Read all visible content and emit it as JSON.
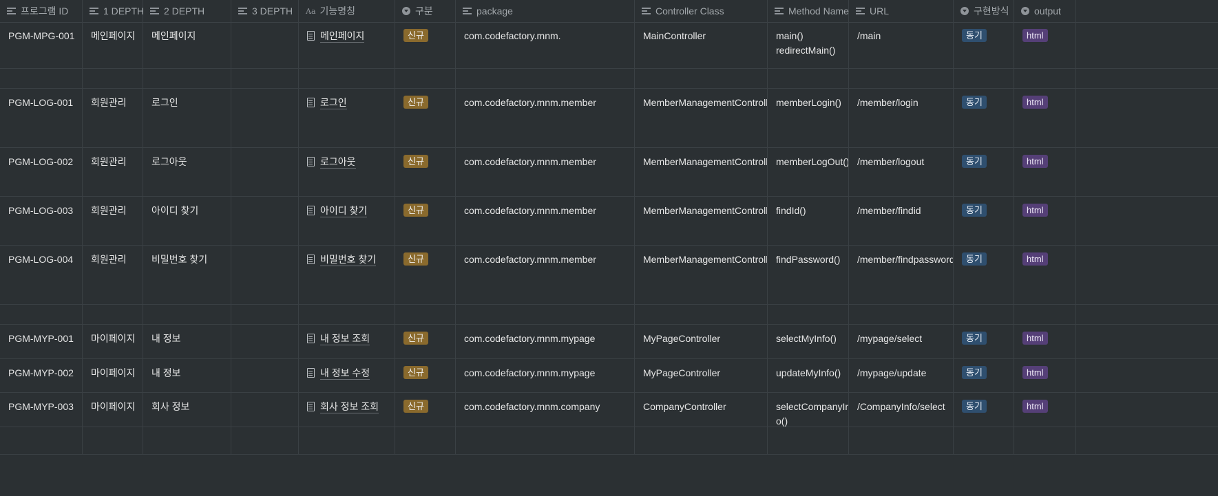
{
  "colors": {
    "background": "#2b3033",
    "badge_new": "#8a6a2d",
    "badge_sync": "#2f4f6f",
    "badge_html": "#553f77"
  },
  "columns": [
    {
      "label": "프로그램 ID",
      "icon": "text-lines-icon"
    },
    {
      "label": "1 DEPTH",
      "icon": "text-lines-icon"
    },
    {
      "label": "2 DEPTH",
      "icon": "text-lines-icon"
    },
    {
      "label": "3 DEPTH",
      "icon": "text-lines-icon"
    },
    {
      "label": "기능명칭",
      "icon": "title-aa-icon"
    },
    {
      "label": "구분",
      "icon": "select-icon"
    },
    {
      "label": "package",
      "icon": "text-lines-icon"
    },
    {
      "label": "Controller Class",
      "icon": "text-lines-icon"
    },
    {
      "label": "Method Name",
      "icon": "text-lines-icon"
    },
    {
      "label": "URL",
      "icon": "text-lines-icon"
    },
    {
      "label": "구현방식",
      "icon": "select-icon"
    },
    {
      "label": "output",
      "icon": "select-icon"
    }
  ],
  "title_icon_text": "Aa",
  "rows": [
    {
      "id": "PGM-MPG-001",
      "d1": "메인페이지",
      "d2": "메인페이지",
      "d3": "",
      "name": "메인페이지",
      "type": "신규",
      "package": "com.codefactory.mnm.",
      "controller": "MainController",
      "method": [
        "main()",
        "redirectMain()"
      ],
      "url": "/main",
      "impl": "동기",
      "output": "html"
    },
    {
      "id": "",
      "d1": "",
      "d2": "",
      "d3": "",
      "name": "",
      "type": "",
      "package": "",
      "controller": "",
      "method": [],
      "url": "",
      "impl": "",
      "output": ""
    },
    {
      "id": "PGM-LOG-001",
      "d1": "회원관리",
      "d2": "로그인",
      "d3": "",
      "name": "로그인",
      "type": "신규",
      "package": "com.codefactory.mnm.member",
      "controller": "MemberManagementController",
      "method": [
        "memberLogin()"
      ],
      "url": "/member/login",
      "impl": "동기",
      "output": "html"
    },
    {
      "id": "PGM-LOG-002",
      "d1": "회원관리",
      "d2": "로그아웃",
      "d3": "",
      "name": "로그아웃",
      "type": "신규",
      "package": "com.codefactory.mnm.member",
      "controller": "MemberManagementController",
      "method": [
        "memberLogOut()"
      ],
      "url": "/member/logout",
      "impl": "동기",
      "output": "html"
    },
    {
      "id": "PGM-LOG-003",
      "d1": "회원관리",
      "d2": "아이디 찾기",
      "d3": "",
      "name": "아이디 찾기",
      "type": "신규",
      "package": "com.codefactory.mnm.member",
      "controller": "MemberManagementController",
      "method": [
        "findId()"
      ],
      "url": "/member/findid",
      "impl": "동기",
      "output": "html"
    },
    {
      "id": "PGM-LOG-004",
      "d1": "회원관리",
      "d2": "비밀번호 찾기",
      "d3": "",
      "name": "비밀번호 찾기",
      "type": "신규",
      "package": "com.codefactory.mnm.member",
      "controller": "MemberManagementController",
      "method": [
        "findPassword()"
      ],
      "url": "/member/findpassword",
      "impl": "동기",
      "output": "html"
    },
    {
      "id": "",
      "d1": "",
      "d2": "",
      "d3": "",
      "name": "",
      "type": "",
      "package": "",
      "controller": "",
      "method": [],
      "url": "",
      "impl": "",
      "output": ""
    },
    {
      "id": "PGM-MYP-001",
      "d1": "마이페이지",
      "d2": "내 정보",
      "d3": "",
      "name": "내 정보 조회",
      "type": "신규",
      "package": "com.codefactory.mnm.mypage",
      "controller": "MyPageController",
      "method": [
        "selectMyInfo()"
      ],
      "url": "/mypage/select",
      "impl": "동기",
      "output": "html"
    },
    {
      "id": "PGM-MYP-002",
      "d1": "마이페이지",
      "d2": "내 정보",
      "d3": "",
      "name": "내 정보 수정",
      "type": "신규",
      "package": "com.codefactory.mnm.mypage",
      "controller": "MyPageController",
      "method": [
        "updateMyInfo()"
      ],
      "url": "/mypage/update",
      "impl": "동기",
      "output": "html"
    },
    {
      "id": "PGM-MYP-003",
      "d1": "마이페이지",
      "d2": "회사 정보",
      "d3": "",
      "name": "회사 정보 조회",
      "type": "신규",
      "package": "com.codefactory.mnm.company",
      "controller": "CompanyController",
      "method": [
        "selectCompanyInf",
        "o()"
      ],
      "url": "/CompanyInfo/select",
      "impl": "동기",
      "output": "html"
    },
    {
      "id": "",
      "d1": "",
      "d2": "",
      "d3": "",
      "name": "",
      "type": "",
      "package": "",
      "controller": "",
      "method": [],
      "url": "",
      "impl": "",
      "output": ""
    }
  ]
}
